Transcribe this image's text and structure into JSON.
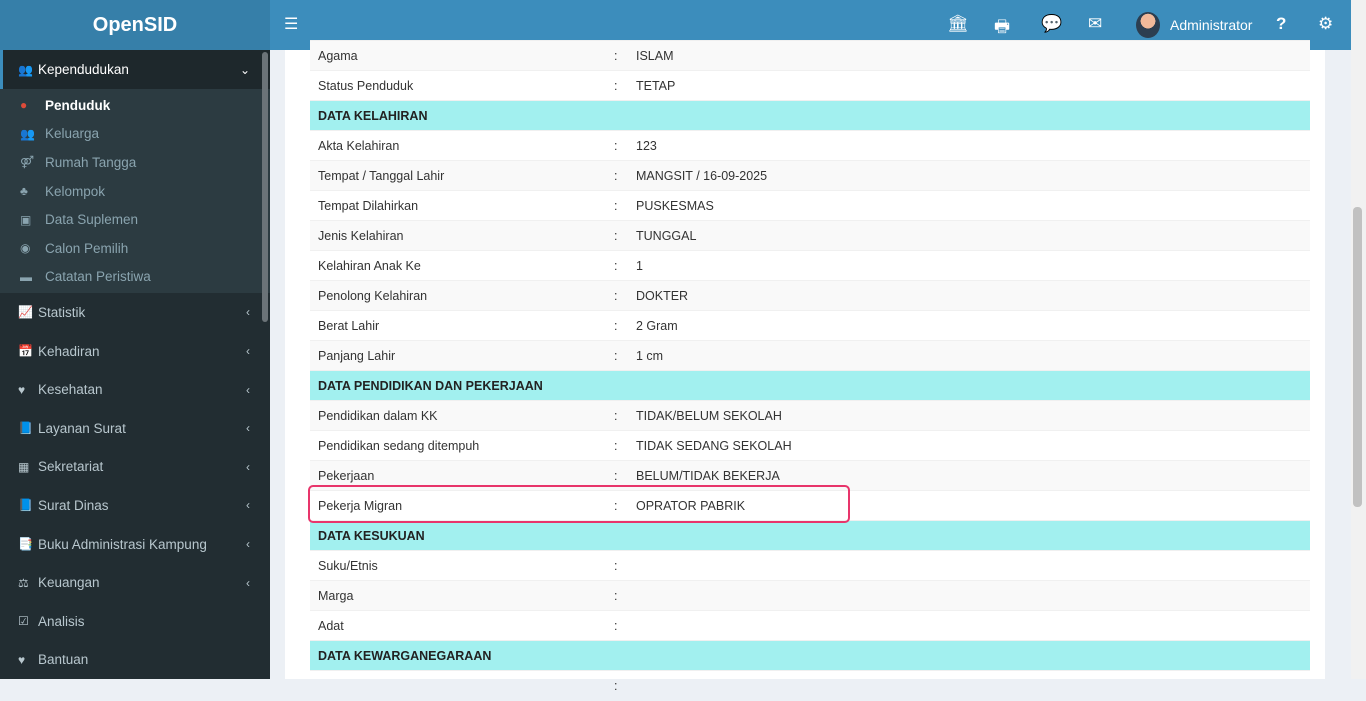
{
  "app": {
    "title": "OpenSID"
  },
  "topbar": {
    "user": "Administrator",
    "icons": [
      "bank-icon",
      "print-icon",
      "chat-icon",
      "mail-icon",
      "help-icon",
      "gear-icon"
    ]
  },
  "sidebar": {
    "active": {
      "label": "Kependudukan",
      "sub": [
        {
          "label": "Penduduk",
          "icon": "user-icon"
        },
        {
          "label": "Keluarga",
          "icon": "users-icon"
        },
        {
          "label": "Rumah Tangga",
          "icon": "venus-mars-icon"
        },
        {
          "label": "Kelompok",
          "icon": "sitemap-icon"
        },
        {
          "label": "Data Suplemen",
          "icon": "inbox-icon"
        },
        {
          "label": "Calon Pemilih",
          "icon": "podcast-icon"
        },
        {
          "label": "Catatan Peristiwa",
          "icon": "archive-icon"
        }
      ]
    },
    "items": [
      {
        "label": "Statistik"
      },
      {
        "label": "Kehadiran"
      },
      {
        "label": "Kesehatan"
      },
      {
        "label": "Layanan Surat"
      },
      {
        "label": "Sekretariat"
      },
      {
        "label": "Surat Dinas"
      },
      {
        "label": "Buku Administrasi Kampung"
      },
      {
        "label": "Keuangan"
      },
      {
        "label": "Analisis"
      },
      {
        "label": "Bantuan"
      }
    ]
  },
  "rows": [
    {
      "k": "Agama",
      "v": "ISLAM"
    },
    {
      "k": "Status Penduduk",
      "v": "TETAP"
    },
    {
      "h": "DATA KELAHIRAN"
    },
    {
      "k": "Akta Kelahiran",
      "v": "123"
    },
    {
      "k": "Tempat / Tanggal Lahir",
      "v": "MANGSIT / 16-09-2025"
    },
    {
      "k": "Tempat Dilahirkan",
      "v": "PUSKESMAS"
    },
    {
      "k": "Jenis Kelahiran",
      "v": "TUNGGAL"
    },
    {
      "k": "Kelahiran Anak Ke",
      "v": "1"
    },
    {
      "k": "Penolong Kelahiran",
      "v": "DOKTER"
    },
    {
      "k": "Berat Lahir",
      "v": "2 Gram"
    },
    {
      "k": "Panjang Lahir",
      "v": "1 cm"
    },
    {
      "h": "DATA PENDIDIKAN DAN PEKERJAAN"
    },
    {
      "k": "Pendidikan dalam KK",
      "v": "TIDAK/BELUM SEKOLAH"
    },
    {
      "k": "Pendidikan sedang ditempuh",
      "v": "TIDAK SEDANG SEKOLAH"
    },
    {
      "k": "Pekerjaan",
      "v": "BELUM/TIDAK BEKERJA"
    },
    {
      "k": "Pekerja Migran",
      "v": "OPRATOR PABRIK"
    },
    {
      "h": "DATA KESUKUAN"
    },
    {
      "k": "Suku/Etnis",
      "v": ""
    },
    {
      "k": "Marga",
      "v": ""
    },
    {
      "k": "Adat",
      "v": ""
    },
    {
      "h": "DATA KEWARGANEGARAAN"
    },
    {
      "k": "",
      "v": ""
    }
  ],
  "sep": ":"
}
